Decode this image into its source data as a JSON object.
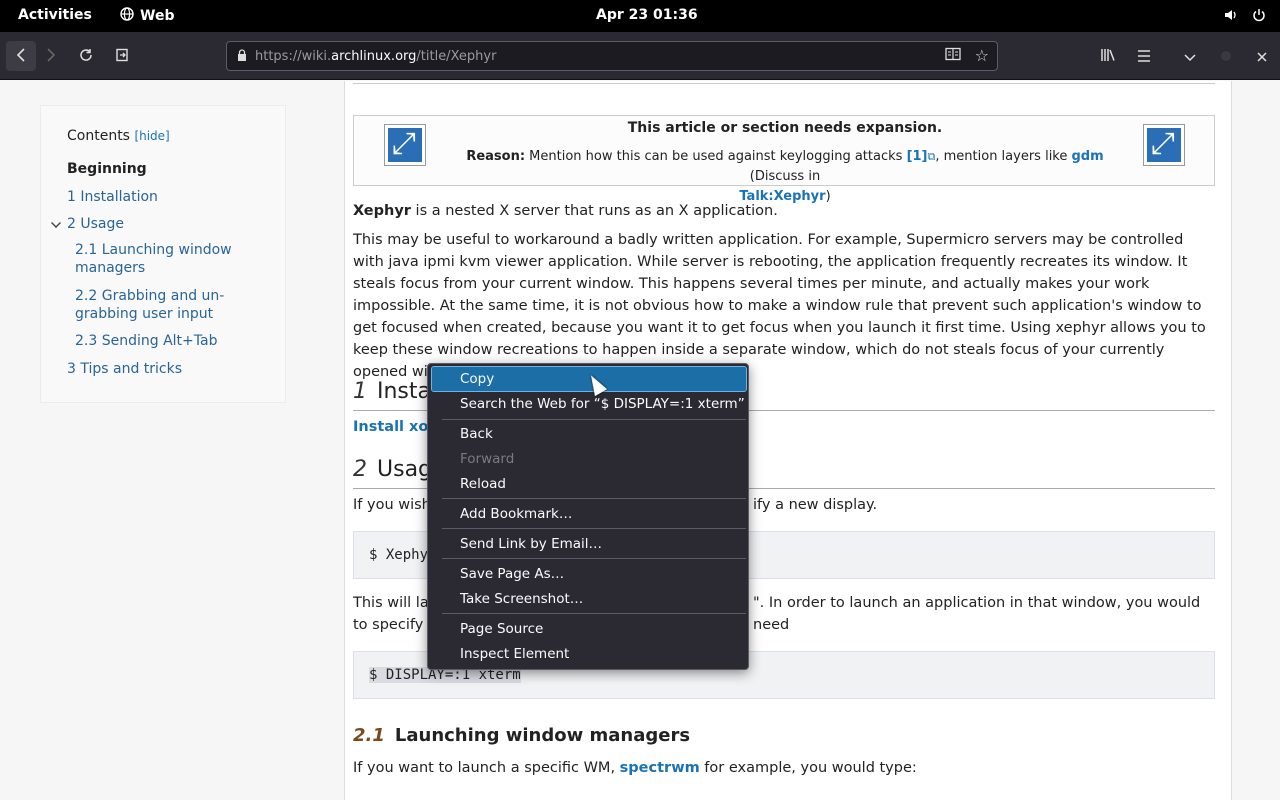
{
  "topbar": {
    "activities": "Activities",
    "app_name": "Web",
    "clock": "Apr 23  01:36",
    "icons": [
      "volume-icon",
      "power-icon"
    ]
  },
  "browser": {
    "url_prefix": "https://wiki.",
    "url_host": "archlinux.org",
    "url_path": "/title/Xephyr",
    "icons": [
      "back-icon",
      "forward-icon",
      "reload-icon",
      "reader-view-icon",
      "bookmark-star-icon",
      "library-icon",
      "menu-icon",
      "chevron-down-icon",
      "close-icon"
    ]
  },
  "toc": {
    "title": "Contents",
    "hide": "[hide]",
    "beginning": "Beginning",
    "items": [
      "1  Installation",
      "2  Usage",
      "2.1  Launching window",
      "managers",
      "2.2  Grabbing and un-",
      "grabbing user input",
      "2.3  Sending Alt+Tab",
      "3  Tips and tricks"
    ]
  },
  "notice": {
    "title": "This article or section needs expansion.",
    "reason_label": "Reason:",
    "reason_text": " Mention how this can be used against keylogging attacks ",
    "ref": "[1]",
    "ref_icon": "⧉",
    "reason_mid": ", mention layers like ",
    "gdm": "gdm",
    "discuss": " (Discuss in ",
    "talk": "Talk:Xephyr",
    "close": ")"
  },
  "article": {
    "intro_bold": "Xephyr",
    "intro_rest": " is a nested X server that runs as an X application.",
    "para2": "This may be useful to workaround a badly written application. For example, Supermicro servers may be controlled with java ipmi kvm viewer application. While server is rebooting, the application frequently recreates its window. It steals focus from your current window. This happens several times per minute, and actually makes your work impossible. At the same time, it is not obvious how to make a window rule that prevent such application's window to get focused when created, because you want it to get focus when you launch it first time. Using xephyr allows you to keep these window recreations to happen inside a separate window, which do not steals focus of your currently opened window.",
    "h_install_num": "1",
    "h_install": "Insta",
    "install_link": "Install xorg",
    "h_usage_num": "2",
    "h_usage": "Usag",
    "usage_p_start": "If you wish",
    "usage_p_end": "ify a new display.",
    "code1": "$ Xephy",
    "launch_p1_start": "This will lau",
    "launch_p1_end": "\". In order to launch an application in that window, you would need",
    "launch_p2": "to specify t",
    "code2": "$ DISPLAY=:1 xterm",
    "h21_num": "2.1",
    "h21": "Launching window managers",
    "wm_p_start": "If you want to launch a specific WM, ",
    "wm_link": "spectrwm",
    "wm_p_end": " for example, you would type:"
  },
  "context_menu": {
    "copy": "Copy",
    "search": "Search the Web for “$ DISPLAY=:1 xterm”",
    "back": "Back",
    "forward": "Forward",
    "reload": "Reload",
    "add_bookmark": "Add Bookmark…",
    "send_link": "Send Link by Email…",
    "save_page": "Save Page As…",
    "screenshot": "Take Screenshot…",
    "page_source": "Page Source",
    "inspect": "Inspect Element"
  }
}
